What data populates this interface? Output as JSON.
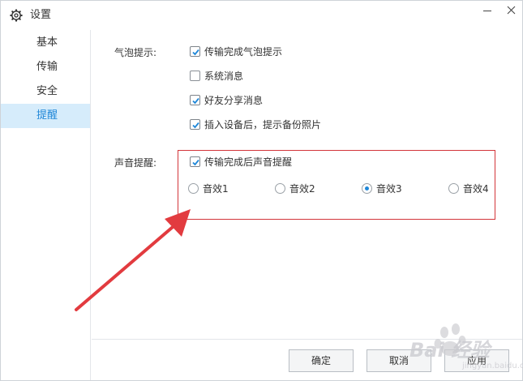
{
  "window": {
    "title": "设置",
    "icons": {
      "title": "gear-icon",
      "minimize": "minimize-icon",
      "close": "close-icon"
    }
  },
  "sidebar": {
    "items": [
      {
        "label": "基本",
        "active": false
      },
      {
        "label": "传输",
        "active": false
      },
      {
        "label": "安全",
        "active": false
      },
      {
        "label": "提醒",
        "active": true
      }
    ]
  },
  "bubble": {
    "label": "气泡提示:",
    "options": [
      {
        "label": "传输完成气泡提示",
        "checked": true
      },
      {
        "label": "系统消息",
        "checked": false
      },
      {
        "label": "好友分享消息",
        "checked": true
      },
      {
        "label": "插入设备后，提示备份照片",
        "checked": true
      }
    ]
  },
  "sound": {
    "label": "声音提醒:",
    "enable": {
      "label": "传输完成后声音提醒",
      "checked": true
    },
    "effects": [
      {
        "label": "音效1",
        "selected": false
      },
      {
        "label": "音效2",
        "selected": false
      },
      {
        "label": "音效3",
        "selected": true
      },
      {
        "label": "音效4",
        "selected": false
      }
    ]
  },
  "buttons": {
    "ok": "确定",
    "cancel": "取消",
    "apply": "应用"
  },
  "watermark": {
    "text": "Bai 经验",
    "sub": "jingyan.baidu.com"
  },
  "colors": {
    "accent": "#1f87d8",
    "active_bg": "#d6ecfb",
    "annotation": "#d3353a"
  }
}
